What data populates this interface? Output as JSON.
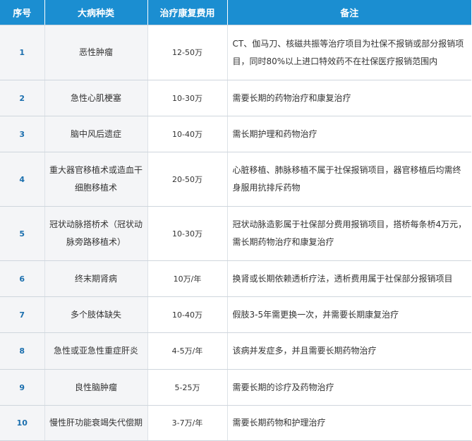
{
  "table": {
    "headers": {
      "no": "序号",
      "name": "大病种类",
      "cost": "治疗康复费用",
      "note": "备注"
    },
    "rows": [
      {
        "no": "1",
        "name": "恶性肿瘤",
        "cost": "12-50万",
        "note": "CT、伽马刀、核磁共振等治疗项目为社保不报销或部分报销项目，同时80%以上进口特效药不在社保医疗报销范围内"
      },
      {
        "no": "2",
        "name": "急性心肌梗塞",
        "cost": "10-30万",
        "note": "需要长期的药物治疗和康复治疗"
      },
      {
        "no": "3",
        "name": "脑中风后遗症",
        "cost": "10-40万",
        "note": "需长期护理和药物治疗"
      },
      {
        "no": "4",
        "name": "重大器官移植术或造血干细胞移植术",
        "cost": "20-50万",
        "note": "心脏移植、肺脉移植不属于社保报销项目，器官移植后均需终身服用抗排斥药物"
      },
      {
        "no": "5",
        "name": "冠状动脉搭桥术（冠状动脉旁路移植术）",
        "cost": "10-30万",
        "note": "冠状动脉造影属于社保部分费用报销项目，搭桥每条桥4万元，需长期药物治疗和康复治疗"
      },
      {
        "no": "6",
        "name": "终末期肾病",
        "cost": "10万/年",
        "note": "换肾或长期依赖透析疗法，透析费用属于社保部分报销项目"
      },
      {
        "no": "7",
        "name": "多个肢体缺失",
        "cost": "10-40万",
        "note": "假肢3-5年需更换一次，并需要长期康复治疗"
      },
      {
        "no": "8",
        "name": "急性或亚急性重症肝炎",
        "cost": "4-5万/年",
        "note": "该病并发症多，并且需要长期药物治疗"
      },
      {
        "no": "9",
        "name": "良性脑肿瘤",
        "cost": "5-25万",
        "note": "需要长期的诊疗及药物治疗"
      },
      {
        "no": "10",
        "name": "慢性肝功能衰竭失代偿期",
        "cost": "3-7万/年",
        "note": "需要长期药物和护理治疗"
      }
    ]
  },
  "colors": {
    "header_bg": "#1b8ed1",
    "header_text": "#ffffff",
    "number_text": "#1b6fae",
    "shaded_cell_bg": "#f4f5f7",
    "body_text": "#333333"
  }
}
